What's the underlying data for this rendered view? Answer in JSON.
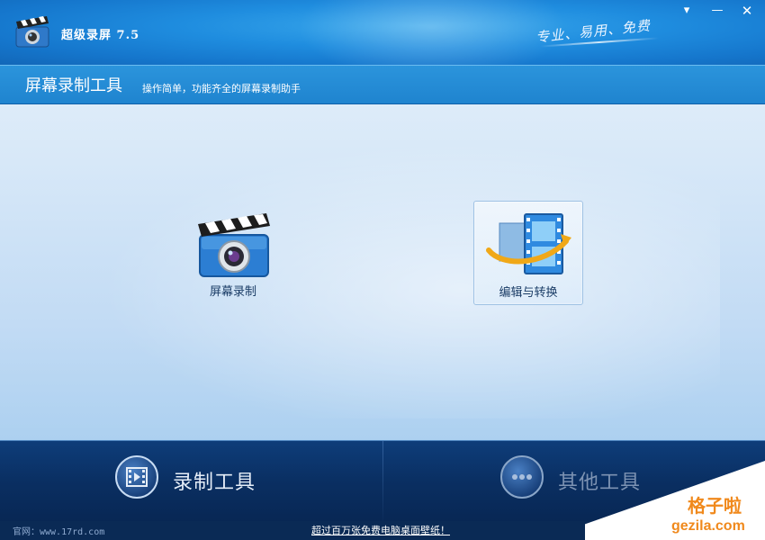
{
  "app": {
    "title": "超级录屏 7.5",
    "slogan": "专业、易用、免费"
  },
  "window_controls": {
    "menu": "▾",
    "minimize": "—",
    "close": "✕"
  },
  "header": {
    "title": "屏幕录制工具",
    "description": "操作简单，功能齐全的屏幕录制助手"
  },
  "features": [
    {
      "label": "屏幕录制",
      "icon": "clapperboard-camera-icon"
    },
    {
      "label": "编辑与转换",
      "icon": "film-convert-icon"
    }
  ],
  "bottom_tabs": [
    {
      "label": "录制工具",
      "icon": "film-icon",
      "active": true
    },
    {
      "label": "其他工具",
      "icon": "more-icon",
      "active": false
    }
  ],
  "status": {
    "site": "官网：www.17rd.com",
    "promo": "超过百万张免费电脑桌面壁纸！"
  },
  "watermark": {
    "line1": "格子啦",
    "line2": "gezila.com"
  },
  "colors": {
    "title_bar": "#1f8ddf",
    "bottom_bar": "#0a2f62",
    "watermark": "#f0891c"
  }
}
